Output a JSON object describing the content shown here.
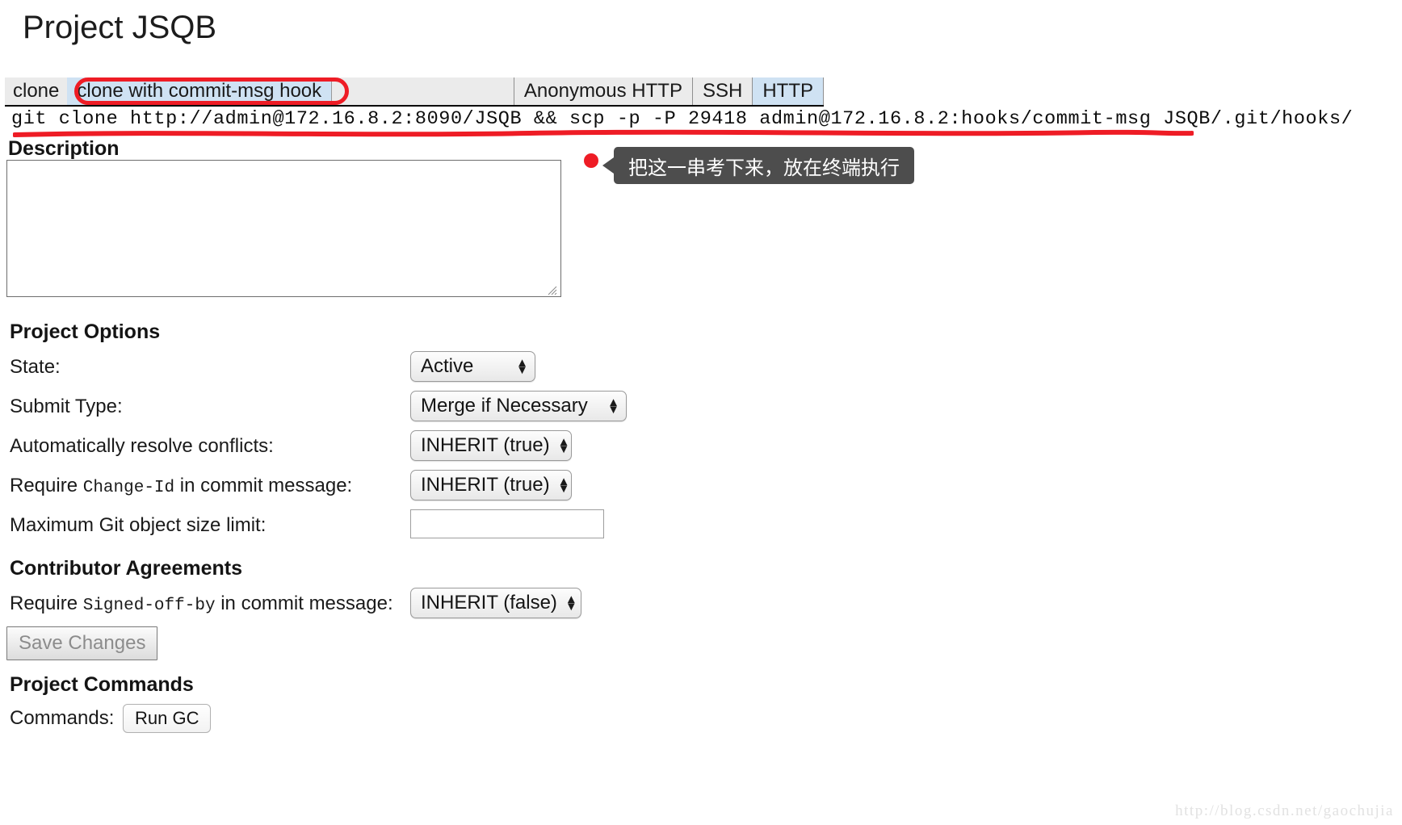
{
  "page": {
    "title": "Project JSQB"
  },
  "clone_bar": {
    "left_label": "clone",
    "selected_command": "clone with commit-msg hook",
    "schemes": [
      {
        "label": "Anonymous HTTP",
        "active": false
      },
      {
        "label": "SSH",
        "active": false
      },
      {
        "label": "HTTP",
        "active": true
      }
    ]
  },
  "command": {
    "text": "git clone http://admin@172.16.8.2:8090/JSQB && scp -p -P 29418 admin@172.16.8.2:hooks/commit-msg JSQB/.git/hooks/"
  },
  "annotations": {
    "highlight_color": "#ee1c25",
    "callout_text": "把这一串考下来，放在终端执行",
    "callout_bg": "#4d4d4d"
  },
  "description": {
    "label": "Description",
    "value": "",
    "placeholder": ""
  },
  "project_options": {
    "heading": "Project Options",
    "rows": [
      {
        "label_prefix": "State:",
        "label_mono": "",
        "label_suffix": "",
        "control": "select",
        "value": "Active"
      },
      {
        "label_prefix": "Submit Type:",
        "label_mono": "",
        "label_suffix": "",
        "control": "select",
        "value": "Merge if Necessary"
      },
      {
        "label_prefix": "Automatically resolve conflicts:",
        "label_mono": "",
        "label_suffix": "",
        "control": "select",
        "value": "INHERIT (true)"
      },
      {
        "label_prefix": "Require ",
        "label_mono": "Change-Id",
        "label_suffix": " in commit message:",
        "control": "select",
        "value": "INHERIT (true)"
      },
      {
        "label_prefix": "Maximum Git object size limit:",
        "label_mono": "",
        "label_suffix": "",
        "control": "text",
        "value": "",
        "placeholder": ""
      }
    ]
  },
  "contributor_agreements": {
    "heading": "Contributor Agreements",
    "row": {
      "label_prefix": "Require ",
      "label_mono": "Signed-off-by",
      "label_suffix": " in commit message:",
      "value": "INHERIT (false)"
    }
  },
  "buttons": {
    "save_changes": "Save Changes",
    "run_gc": "Run GC"
  },
  "project_commands": {
    "heading": "Project Commands",
    "commands_label": "Commands:"
  },
  "watermark": {
    "text": "http://blog.csdn.net/gaochujia"
  }
}
